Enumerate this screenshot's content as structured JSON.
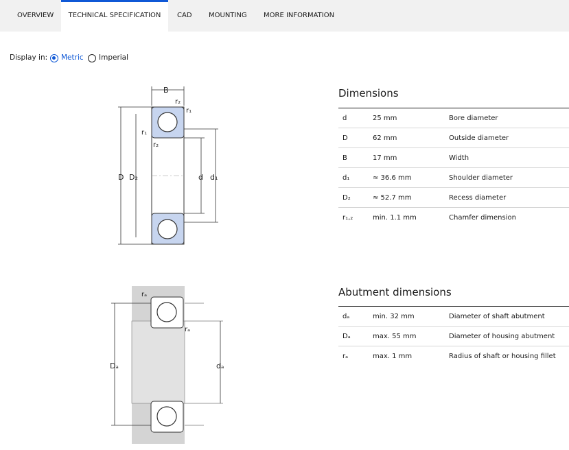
{
  "tabs": [
    {
      "label": "OVERVIEW",
      "active": false
    },
    {
      "label": "TECHNICAL SPECIFICATION",
      "active": true
    },
    {
      "label": "CAD",
      "active": false
    },
    {
      "label": "MOUNTING",
      "active": false
    },
    {
      "label": "MORE INFORMATION",
      "active": false
    }
  ],
  "display": {
    "label": "Display in:",
    "options": [
      {
        "label": "Metric",
        "selected": true
      },
      {
        "label": "Imperial",
        "selected": false
      }
    ]
  },
  "dimensions": {
    "title": "Dimensions",
    "rows": [
      {
        "symbol": "d",
        "value": "25 mm",
        "description": "Bore diameter"
      },
      {
        "symbol": "D",
        "value": "62 mm",
        "description": "Outside diameter"
      },
      {
        "symbol": "B",
        "value": "17 mm",
        "description": "Width"
      },
      {
        "symbol": "d₁",
        "value": "≈ 36.6 mm",
        "description": "Shoulder diameter"
      },
      {
        "symbol": "D₂",
        "value": "≈ 52.7 mm",
        "description": "Recess diameter"
      },
      {
        "symbol": "r₁,₂",
        "value": "min. 1.1 mm",
        "description": "Chamfer dimension"
      }
    ]
  },
  "abutment": {
    "title": "Abutment dimensions",
    "rows": [
      {
        "symbol": "dₐ",
        "value": "min. 32 mm",
        "description": "Diameter of shaft abutment"
      },
      {
        "symbol": "Dₐ",
        "value": "max. 55 mm",
        "description": "Diameter of housing abutment"
      },
      {
        "symbol": "rₐ",
        "value": "max. 1 mm",
        "description": "Radius of shaft or housing fillet"
      }
    ]
  },
  "bearing_drawing": {
    "labels": {
      "B": "B",
      "r1": "r₁",
      "r2": "r₂",
      "D": "D",
      "D2": "D₂",
      "d": "d",
      "d1": "d₁"
    }
  },
  "abutment_drawing": {
    "labels": {
      "ra": "rₐ",
      "Da": "Dₐ",
      "da": "dₐ"
    }
  },
  "colors": {
    "accent": "#0f58d6",
    "bearing_fill": "#c7d5ef",
    "housing_fill": "#d4d4d4"
  }
}
